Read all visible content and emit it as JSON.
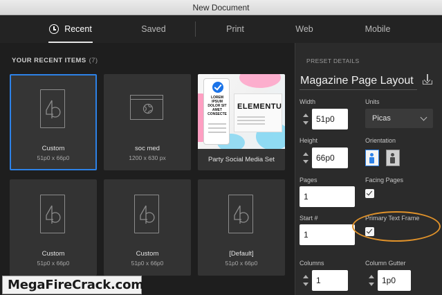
{
  "window": {
    "title": "New Document"
  },
  "tabs": [
    {
      "label": "Recent",
      "active": true
    },
    {
      "label": "Saved"
    },
    {
      "label": "Print"
    },
    {
      "label": "Web"
    },
    {
      "label": "Mobile"
    }
  ],
  "recent": {
    "header": "YOUR RECENT ITEMS",
    "count": "(7)",
    "items": [
      {
        "label": "Custom",
        "sub": "51p0 x 66p0",
        "icon": "document-icon",
        "selected": true
      },
      {
        "label": "soc med",
        "sub": "1200 x 630 px",
        "icon": "web-icon"
      },
      {
        "label": "Party Social Media Set",
        "thumb_text": "ELEMENTU",
        "phone_text": "LOREM IPSUM DOLOR SIT AMET CONSECTE"
      },
      {
        "label": "Custom",
        "sub": "51p0 x 66p0",
        "icon": "document-icon"
      },
      {
        "label": "Custom",
        "sub": "51p0 x 66p0",
        "icon": "document-icon"
      },
      {
        "label": "[Default]",
        "sub": "51p0 x 66p0",
        "icon": "document-icon"
      }
    ]
  },
  "preset": {
    "section_label": "PRESET DETAILS",
    "name": "Magazine Page Layout",
    "width_label": "Width",
    "width_value": "51p0",
    "units_label": "Units",
    "units_value": "Picas",
    "height_label": "Height",
    "height_value": "66p0",
    "orientation_label": "Orientation",
    "pages_label": "Pages",
    "pages_value": "1",
    "facing_pages_label": "Facing Pages",
    "facing_pages_checked": true,
    "start_label": "Start #",
    "start_value": "1",
    "primary_text_frame_label": "Primary Text Frame",
    "primary_text_frame_checked": true,
    "columns_label": "Columns",
    "columns_value": "1",
    "gutter_label": "Column Gutter",
    "gutter_value": "1p0"
  },
  "colors": {
    "accent": "#2d82e8",
    "highlight": "#e0922a"
  },
  "watermark": "MegaFireCrack.com"
}
